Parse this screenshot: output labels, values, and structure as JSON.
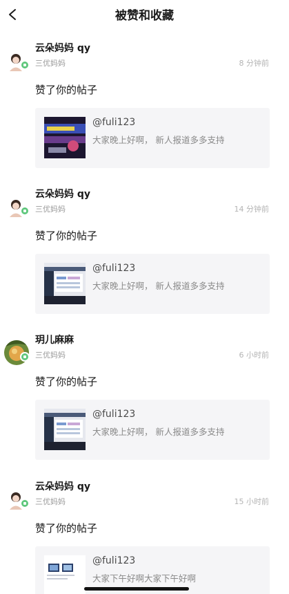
{
  "header": {
    "title": "被赞和收藏"
  },
  "notifications": [
    {
      "username": "云朵妈妈 qy",
      "level": "三优妈妈",
      "time": "8 分钟前",
      "action": "赞了你的帖子",
      "post": {
        "author": "@fuli123",
        "excerpt": "大家晚上好啊， 新人报道多多支持"
      }
    },
    {
      "username": "云朵妈妈 qy",
      "level": "三优妈妈",
      "time": "14 分钟前",
      "action": "赞了你的帖子",
      "post": {
        "author": "@fuli123",
        "excerpt": "大家晚上好啊， 新人报道多多支持"
      }
    },
    {
      "username": "玥儿麻麻",
      "level": "三优妈妈",
      "time": "6 小时前",
      "action": "赞了你的帖子",
      "post": {
        "author": "@fuli123",
        "excerpt": "大家晚上好啊， 新人报道多多支持"
      }
    },
    {
      "username": "云朵妈妈 qy",
      "level": "三优妈妈",
      "time": "15 小时前",
      "action": "赞了你的帖子",
      "post": {
        "author": "@fuli123",
        "excerpt": "大家下午好啊大家下午好啊"
      }
    }
  ],
  "colors": {
    "badge": "#5fc77c",
    "card_bg": "#f5f5f7",
    "meta": "#9a9a9a"
  },
  "icons": {
    "back": "chevron-left-icon",
    "badge": "level-badge-icon"
  }
}
